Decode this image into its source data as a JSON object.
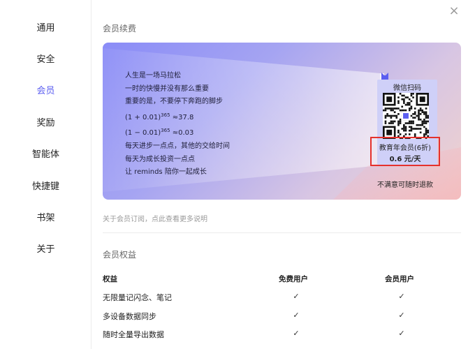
{
  "sidebar": {
    "items": [
      {
        "label": "通用"
      },
      {
        "label": "安全"
      },
      {
        "label": "会员"
      },
      {
        "label": "奖励"
      },
      {
        "label": "智能体"
      },
      {
        "label": "快捷键"
      },
      {
        "label": "书架"
      },
      {
        "label": "关于"
      }
    ],
    "active_index": 2
  },
  "close_glyph": "×",
  "membership": {
    "section_title": "会员续费",
    "quote": {
      "line1": "人生是一场马拉松",
      "line2": "一时的快慢并没有那么重要",
      "line3": "重要的是，不要停下奔跑的脚步",
      "line4_pre": "(1 + 0.01)",
      "line4_sup": "365",
      "line4_post": " ≈37.8",
      "line5_pre": "(1 − 0.01)",
      "line5_sup": "365",
      "line5_post": " ≈0.03",
      "line6": "每天进步一点点，其他的交给时间",
      "line7": "每天为成长投资一点点",
      "line8": "让 reminds 陪你一起成长"
    },
    "qr_title": "微信扫码",
    "plan_name": "教育年会员(6折)",
    "plan_price": "0.6 元/天",
    "refund_note": "不满意可随时退款",
    "note_link": "关于会员订阅，点此查看更多说明"
  },
  "benefits": {
    "section_title": "会员权益",
    "headers": [
      "权益",
      "免费用户",
      "会员用户"
    ],
    "rows": [
      {
        "name": "无限量记闪念、笔记",
        "free": "✓",
        "member": "✓"
      },
      {
        "name": "多设备数据同步",
        "free": "✓",
        "member": "✓"
      },
      {
        "name": "随时全量导出数据",
        "free": "✓",
        "member": "✓"
      }
    ]
  },
  "colors": {
    "accent": "#5b5ef0",
    "highlight_border": "#e5312c"
  }
}
